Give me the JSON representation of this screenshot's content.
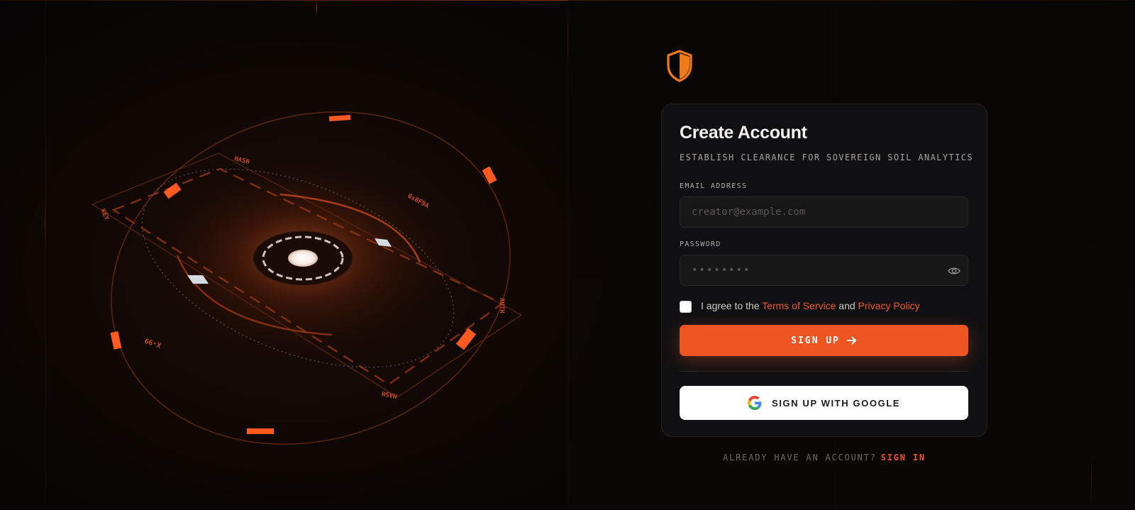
{
  "hero": {
    "ring_labels": [
      "HASH",
      "0x8F9A",
      "AUTH",
      "HASH",
      "X-99",
      "KEY"
    ]
  },
  "brand": {
    "logo_icon": "shield-icon",
    "accent_color": "#ee5523"
  },
  "form": {
    "title": "Create Account",
    "subtitle": "ESTABLISH CLEARANCE FOR SOVEREIGN SOIL ANALYTICS",
    "email": {
      "label": "EMAIL ADDRESS",
      "placeholder": "creator@example.com",
      "value": ""
    },
    "password": {
      "label": "PASSWORD",
      "placeholder": "••••••••",
      "value": "",
      "toggle_icon": "eye-icon"
    },
    "agree": {
      "prefix": "I agree to the",
      "terms_label": "Terms of Service",
      "and": "and",
      "privacy_label": "Privacy Policy",
      "checked": false
    },
    "signup_label": "SIGN UP",
    "signup_icon": "arrow-right-icon",
    "google_label": "SIGN UP WITH GOOGLE",
    "google_icon": "google-icon"
  },
  "footer": {
    "prompt": "ALREADY HAVE AN ACCOUNT?",
    "signin_label": "SIGN IN"
  }
}
